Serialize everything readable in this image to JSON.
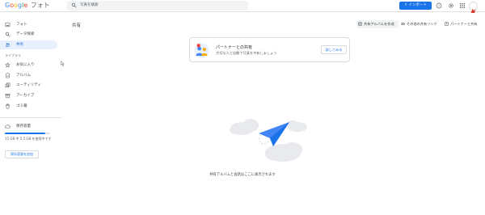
{
  "app": {
    "logo": {
      "brand": "Google",
      "product": "フォト"
    }
  },
  "topbar": {
    "search_placeholder": "写真を検索",
    "import_label": "インポート",
    "icons": [
      "upload-icon",
      "help-icon",
      "settings-icon",
      "apps-icon",
      "account-avatar"
    ]
  },
  "sidebar": {
    "items": [
      {
        "label": "フォト",
        "icon": "photo-icon",
        "active": false
      },
      {
        "label": "データ探索",
        "icon": "search-icon",
        "active": false
      },
      {
        "label": "共有",
        "icon": "people-icon",
        "active": true
      }
    ],
    "library_label": "ライブラリ",
    "library_items": [
      {
        "label": "お気に入り",
        "icon": "star-icon"
      },
      {
        "label": "アルバム",
        "icon": "album-icon"
      },
      {
        "label": "ユーティリティ",
        "icon": "utilities-icon"
      },
      {
        "label": "アーカイブ",
        "icon": "archive-icon"
      },
      {
        "label": "ゴミ箱",
        "icon": "trash-icon"
      }
    ],
    "storage": {
      "label": "保存容量",
      "used_fraction": 0.9,
      "text": "15 GB 中 5.5 GB を使用中です",
      "buy_label": "保存容量を追加"
    }
  },
  "main": {
    "title": "共有",
    "actions": [
      {
        "label": "共有アルバムを作成",
        "icon": "add-album-icon",
        "selected": true
      },
      {
        "label": "その他の共有リンク",
        "icon": "link-icon",
        "selected": false
      },
      {
        "label": "パートナーと共有",
        "icon": "partner-icon",
        "selected": false
      }
    ],
    "promo": {
      "title": "パートナーとの共有",
      "subtitle": "大切な人と自動で写真を共有しましょう",
      "button": "試してみる"
    },
    "empty_text": "共有アルバムと会話はここに表示されます"
  },
  "colors": {
    "accent": "#1a73e8",
    "active_bg": "#e8f0fe",
    "empty_plane": "#4285f4",
    "cloud": "#e8eaed"
  }
}
